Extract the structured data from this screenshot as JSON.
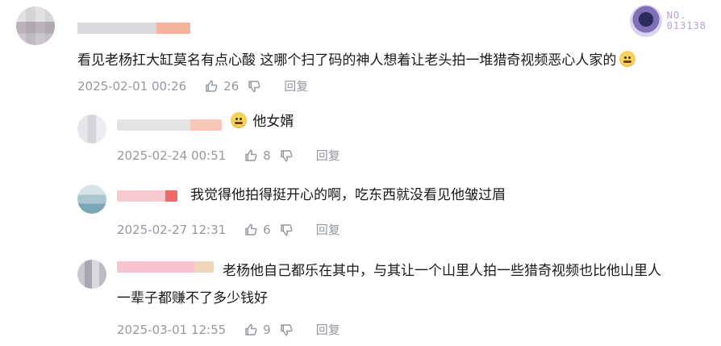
{
  "badge": {
    "line1": "NO.",
    "line2": "013138"
  },
  "main_comment": {
    "text": "看见老杨扛大缸莫名有点心酸 这哪个扫了码的神人想着让老头拍一堆猎奇视频恶心人家的",
    "time": "2025-02-01 00:26",
    "likes": "26",
    "reply_label": "回复"
  },
  "replies": [
    {
      "text": "他女婿",
      "time": "2025-02-24 00:51",
      "likes": "8",
      "reply_label": "回复"
    },
    {
      "text": "我觉得他拍得挺开心的啊，吃东西就没看见他皱过眉",
      "time": "2025-02-27 12:31",
      "likes": "6",
      "reply_label": "回复"
    },
    {
      "text_line1": "老杨他自己都乐在其中，与其让一个山里人拍一些猎奇视频也比他山里人",
      "text_line2": "一辈子都赚不了多少钱好",
      "time": "2025-03-01 12:55",
      "likes": "9",
      "reply_label": "回复"
    }
  ],
  "icons": {
    "like": "thumbs-up-icon",
    "dislike": "thumbs-down-icon",
    "emoji": "laughing-emoji-icon"
  }
}
